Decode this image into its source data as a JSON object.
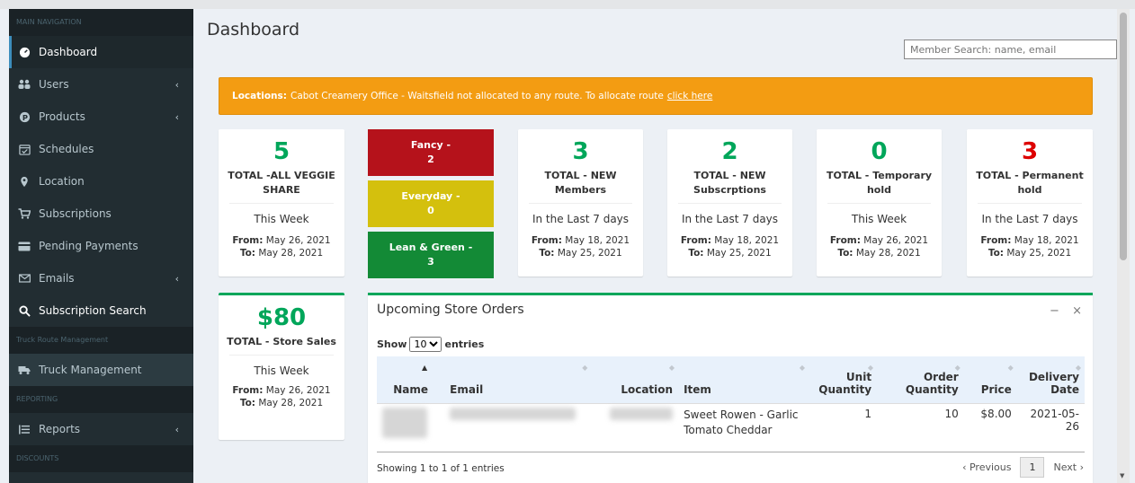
{
  "sidebar": {
    "header_main": "MAIN NAVIGATION",
    "items": [
      {
        "label": "Dashboard",
        "icon": "dashboard-icon"
      },
      {
        "label": "Users",
        "icon": "users-icon"
      },
      {
        "label": "Products",
        "icon": "products-icon"
      },
      {
        "label": "Schedules",
        "icon": "calendar-icon"
      },
      {
        "label": "Location",
        "icon": "map-marker-icon"
      },
      {
        "label": "Subscriptions",
        "icon": "cart-icon"
      },
      {
        "label": "Pending Payments",
        "icon": "credit-card-icon"
      },
      {
        "label": "Emails",
        "icon": "envelope-icon"
      },
      {
        "label": "Subscription Search",
        "icon": "search-icon"
      }
    ],
    "header_truck": "Truck Route Management",
    "truck_item": "Truck Management",
    "header_reporting": "REPORTING",
    "reports_item": "Reports",
    "header_discounts": "DISCOUNTS"
  },
  "page": {
    "title": "Dashboard",
    "search_placeholder": "Member Search: name, email"
  },
  "alert": {
    "prefix": "Locations:",
    "message": "Cabot Creamery Office - Waitsfield not allocated to any route. To allocate route",
    "link": "click here",
    "color": "#f39c12"
  },
  "cards": {
    "veggie": {
      "value": "5",
      "label": "TOTAL -ALL VEGGIE SHARE",
      "period": "This Week",
      "from_label": "From:",
      "from": "May 26, 2021",
      "to_label": "To:",
      "to": "May 28, 2021"
    },
    "members": {
      "value": "3",
      "label": "TOTAL - NEW Members",
      "period": "In the Last 7 days",
      "from_label": "From:",
      "from": "May 18, 2021",
      "to_label": "To:",
      "to": "May 25, 2021"
    },
    "subscriptions": {
      "value": "2",
      "label": "TOTAL - NEW Subscrptions",
      "period": "In the Last 7 days",
      "from_label": "From:",
      "from": "May 18, 2021",
      "to_label": "To:",
      "to": "May 25, 2021"
    },
    "temporary": {
      "value": "0",
      "label": "TOTAL - Temporary hold",
      "period": "This Week",
      "from_label": "From:",
      "from": "May 26, 2021",
      "to_label": "To:",
      "to": "May 28, 2021"
    },
    "permanent": {
      "value": "3",
      "label": "TOTAL - Permanent hold",
      "period": "In the Last 7 days",
      "from_label": "From:",
      "from": "May 18, 2021",
      "to_label": "To:",
      "to": "May 25, 2021"
    },
    "sales": {
      "value": "$80",
      "label": "TOTAL - Store Sales",
      "period": "This Week",
      "from_label": "From:",
      "from": "May 26, 2021",
      "to_label": "To:",
      "to": "May 28, 2021"
    }
  },
  "categories": [
    {
      "name": "Fancy -",
      "count": "2",
      "color": "#b5121b"
    },
    {
      "name": "Everyday -",
      "count": "0",
      "color": "#d4c00d"
    },
    {
      "name": "Lean & Green -",
      "count": "3",
      "color": "#138a36"
    }
  ],
  "orders": {
    "title": "Upcoming Store Orders",
    "show_label": "Show",
    "entries_label": "entries",
    "page_size": "10",
    "columns": {
      "name": "Name",
      "email": "Email",
      "location": "Location",
      "item": "Item",
      "unit_qty": "Unit Quantity",
      "order_qty": "Order Quantity",
      "price": "Price",
      "delivery": "Delivery Date"
    },
    "rows": [
      {
        "item": "Sweet Rowen - Garlic Tomato Cheddar",
        "unit_qty": "1",
        "order_qty": "10",
        "price": "$8.00",
        "delivery": "2021-05-26"
      }
    ],
    "info": "Showing 1 to 1 of 1 entries",
    "prev": "‹ Previous",
    "page": "1",
    "next": "Next ›"
  }
}
